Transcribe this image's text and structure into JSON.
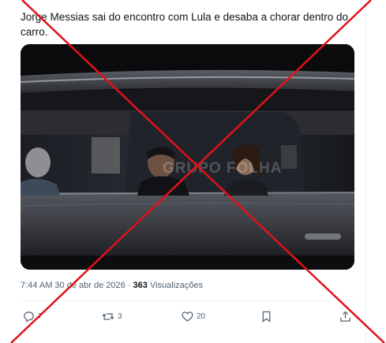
{
  "post": {
    "text": "Jorge Messias sai do encontro com Lula e desaba a chorar dentro do carro.",
    "time": "7:44 AM",
    "date": "30 de abr de 2026",
    "separator": "·",
    "views_count": "363",
    "views_label": "Visualizações"
  },
  "media": {
    "watermark": "GRUPO FOLHA"
  },
  "actions": {
    "reply_icon": "reply-icon",
    "reply_count": "7",
    "repost_icon": "repost-icon",
    "repost_count": "3",
    "like_icon": "like-icon",
    "like_count": "20",
    "bookmark_icon": "bookmark-icon",
    "share_icon": "share-icon"
  },
  "overlay": {
    "cross_color": "#e0121a"
  },
  "colors": {
    "text": "#0f1419",
    "secondary": "#536471",
    "divider": "#eff3f4"
  }
}
